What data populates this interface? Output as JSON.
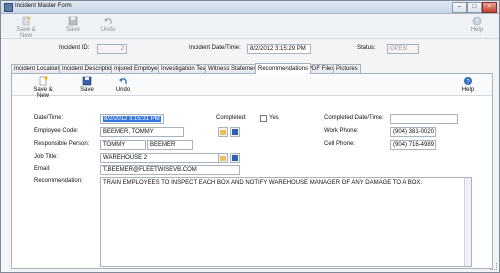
{
  "window": {
    "title": "Incident Master Form"
  },
  "toolbar": {
    "save_new": "Save & New",
    "save": "Save",
    "undo": "Undo",
    "help": "Help"
  },
  "header": {
    "incident_id_label": "Incident ID:",
    "incident_id_value": "2",
    "incident_datetime_label": "Incident Date/Time:",
    "incident_datetime_value": "8/2/2012 3:15:29 PM",
    "status_label": "Status:",
    "status_value": "OPEN"
  },
  "tabs": [
    {
      "label": "Incident Location"
    },
    {
      "label": "Incident Description"
    },
    {
      "label": "Injured Employees"
    },
    {
      "label": "Investigation Team"
    },
    {
      "label": "Witness Statements"
    },
    {
      "label": "Recommendations",
      "active": true
    },
    {
      "label": "PDF Files"
    },
    {
      "label": "Pictures"
    }
  ],
  "panel_toolbar": {
    "save_new": "Save & New",
    "save": "Save",
    "undo": "Undo",
    "help": "Help"
  },
  "form": {
    "datetime_label": "Date/Time:",
    "datetime_value": "8/2/2012 3:15:31 PM",
    "completed_label": "Completed:",
    "completed_option": "Yes",
    "completed_datetime_label": "Completed Date/Time:",
    "completed_datetime_value": "",
    "employee_code_label": "Employee Code:",
    "employee_code_value": "BEEMER, TOMMY",
    "work_phone_label": "Work Phone:",
    "work_phone_value": "(904) 381-0020",
    "responsible_person_label": "Responsible Person:",
    "responsible_first": "TOMMY",
    "responsible_last": "BEEMER",
    "cell_phone_label": "Cell Phone:",
    "cell_phone_value": "(904) 716-4989",
    "job_title_label": "Job Title:",
    "job_title_value": "WAREHOUSE 2",
    "email_label": "Email:",
    "email_value": "T.BEEMER@FLEETWISEVB.COM",
    "recommendation_label": "Recommendation:",
    "recommendation_value": "TRAIN EMPLOYEES TO INSPECT EACH BOX AND NOTIFY WAREHOUSE MANAGER OF ANY DAMAGE TO A BOX."
  },
  "icons": {
    "save_new": "new-document-icon",
    "save": "floppy-disk-icon",
    "undo": "undo-arrow-icon",
    "help": "help-circle-icon",
    "lookup": "folder-open-icon",
    "edit": "edit-pencil-icon"
  }
}
